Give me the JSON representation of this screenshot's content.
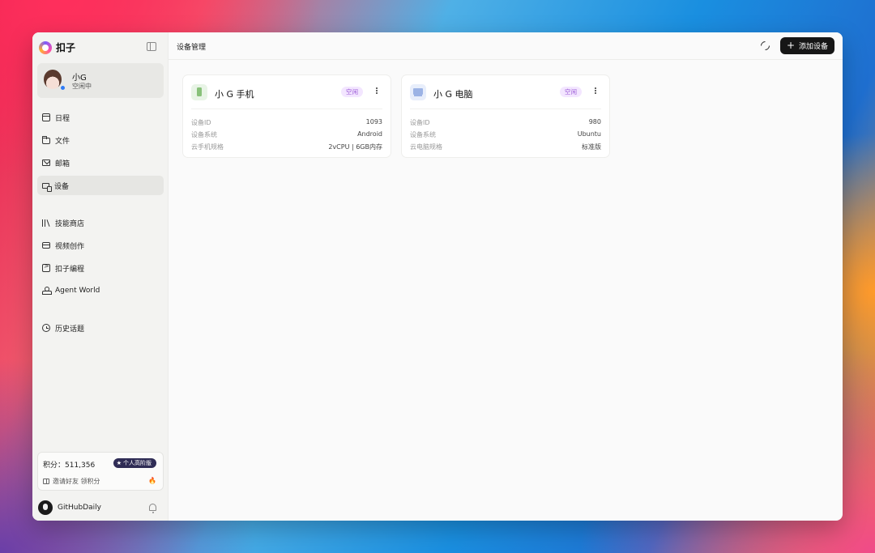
{
  "sidebar": {
    "brand": "扣子",
    "user": {
      "name": "小G",
      "status": "空闲中"
    },
    "items": [
      {
        "label": "日程"
      },
      {
        "label": "文件"
      },
      {
        "label": "邮箱"
      },
      {
        "label": "设备"
      },
      {
        "label": "技能商店"
      },
      {
        "label": "视频创作"
      },
      {
        "label": "扣子编程"
      },
      {
        "label": "Agent World"
      },
      {
        "label": "历史话题"
      }
    ],
    "points": {
      "text": "积分：511,356",
      "plan": "个人高阶版",
      "invite": "邀请好友 领积分"
    },
    "footer_user": "GitHubDaily"
  },
  "main": {
    "title": "设备管理",
    "add_button": "添加设备",
    "devices": [
      {
        "name": "小 G 手机",
        "status": "空闲",
        "rows": [
          {
            "label": "设备ID",
            "value": "1093"
          },
          {
            "label": "设备系统",
            "value": "Android"
          },
          {
            "label": "云手机规格",
            "value": "2vCPU | 6GB内存"
          }
        ]
      },
      {
        "name": "小 G 电脑",
        "status": "空闲",
        "rows": [
          {
            "label": "设备ID",
            "value": "980"
          },
          {
            "label": "设备系统",
            "value": "Ubuntu"
          },
          {
            "label": "云电脑规格",
            "value": "标准版"
          }
        ]
      }
    ]
  },
  "colors": {
    "accent": "#161616",
    "status_bg": "#f3e6ff",
    "status_text": "#9b5ad6",
    "plan_badge": "#2f2c55"
  }
}
